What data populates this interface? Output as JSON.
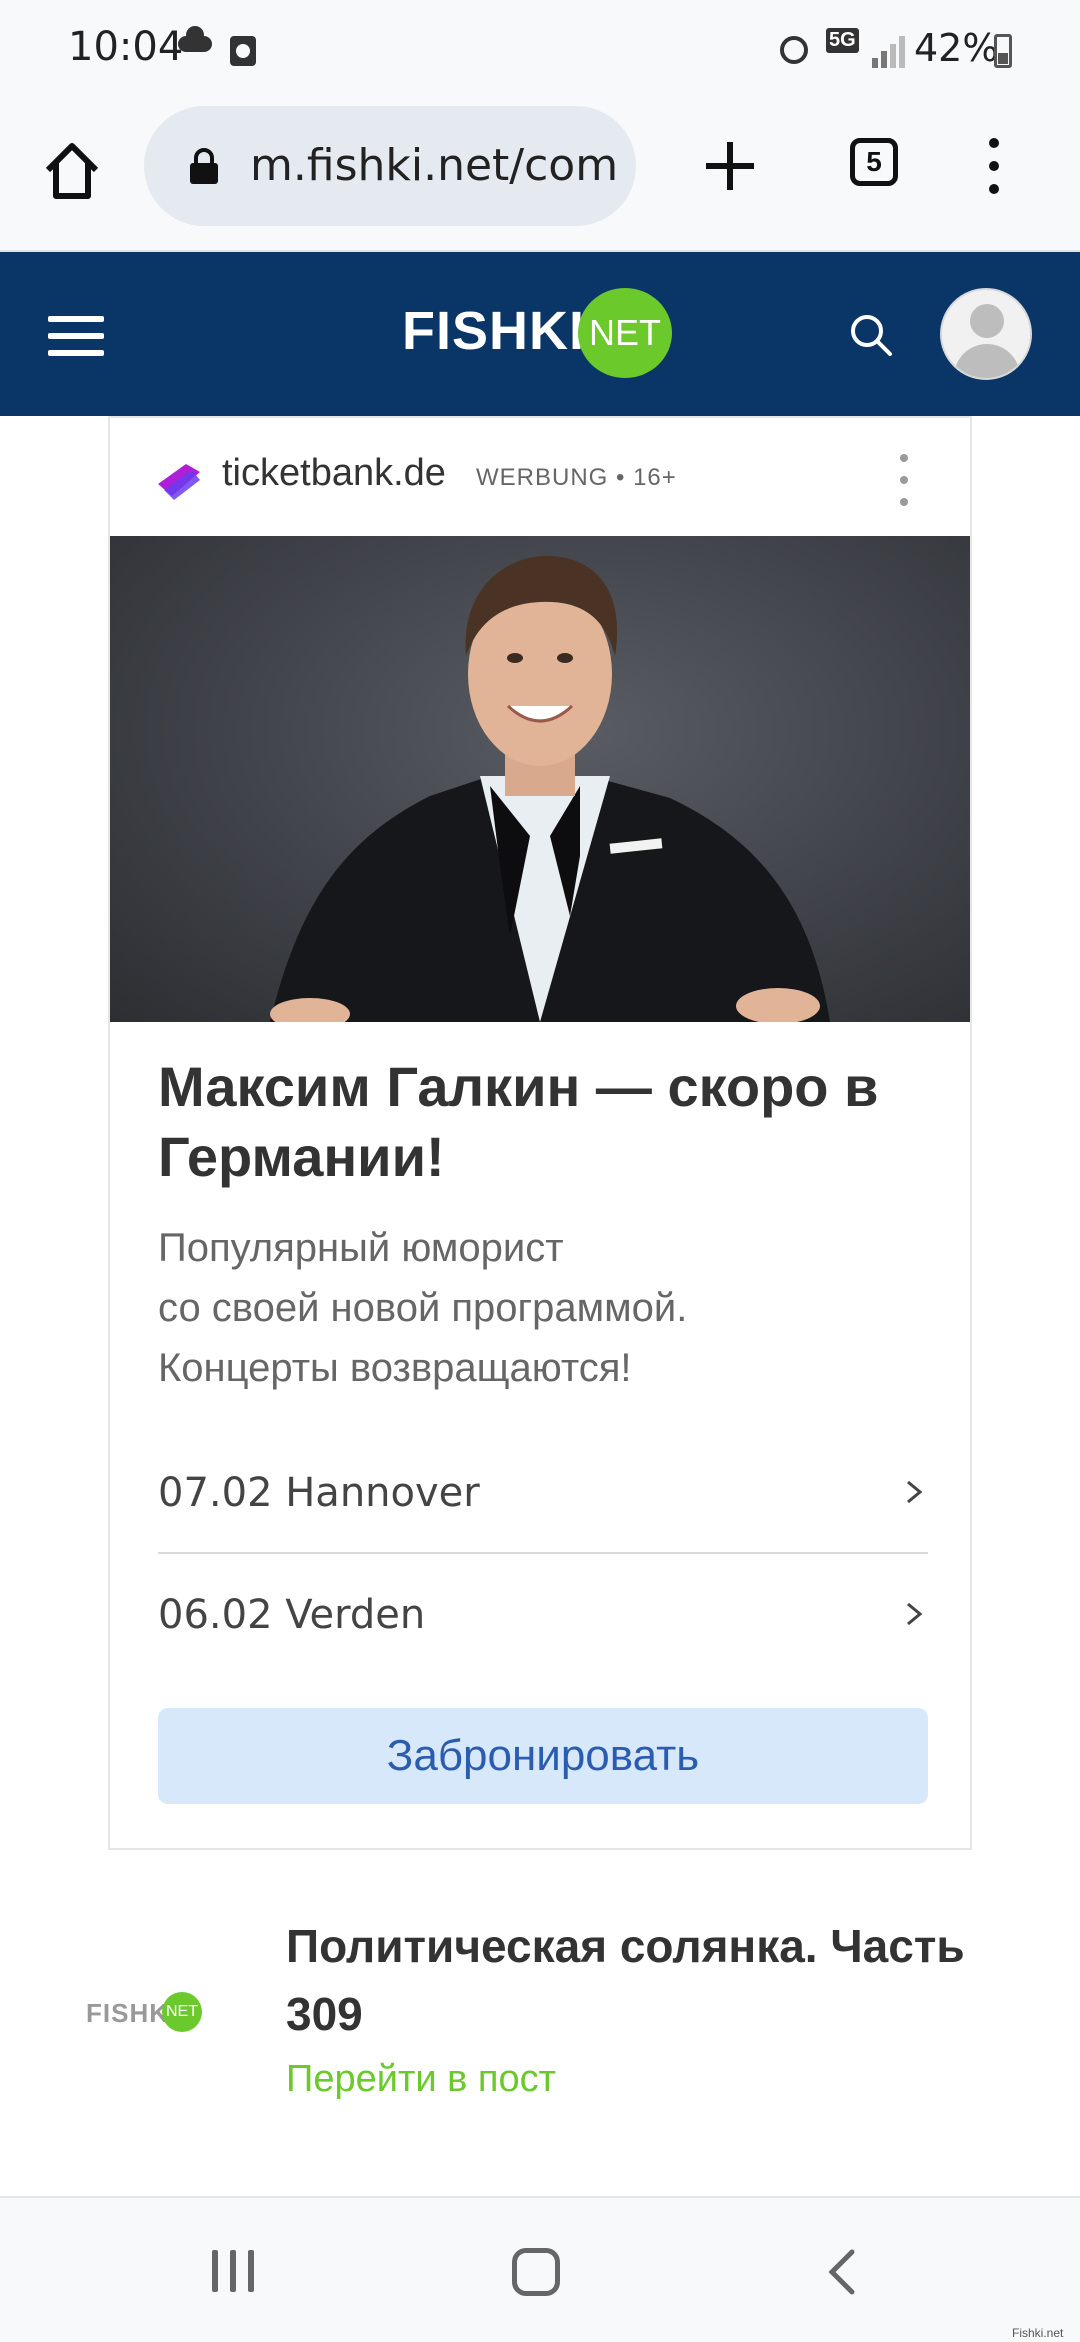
{
  "status_bar": {
    "time": "10:04",
    "network": "5G",
    "battery": "42%"
  },
  "browser": {
    "url": "m.fishki.net/com",
    "tab_count": "5"
  },
  "site_header": {
    "logo_word": "FISHKI",
    "logo_badge": "NET"
  },
  "ad": {
    "domain": "ticketbank.de",
    "meta": "WERBUNG • 16+",
    "title": "Максим Галкин — скоро в Германии!",
    "description": "Популярный юморист\nсо своей новой программой.\nКонцерты возвращаются!",
    "events": [
      {
        "label": "07.02 Hannover"
      },
      {
        "label": "06.02 Verden"
      }
    ],
    "cta": "Забронировать"
  },
  "promo": {
    "logo_word": "FISHKI",
    "logo_badge": "NET",
    "title": "Политическая солянка. Часть 309",
    "link": "Перейти в пост"
  },
  "watermark": "Fishki.net",
  "colors": {
    "header_bg": "#0a3567",
    "logo_green": "#6bc92b",
    "cta_bg": "#d8e8fb",
    "cta_text": "#2a5db0"
  }
}
